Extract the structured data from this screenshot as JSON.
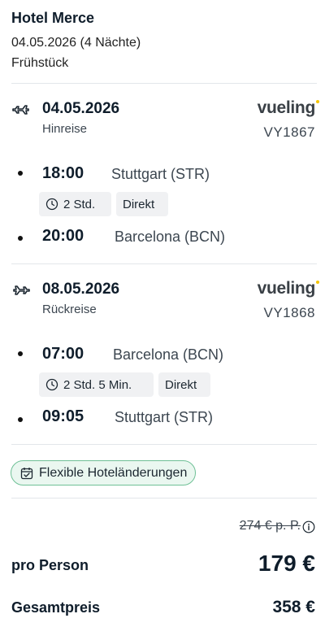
{
  "hotel": {
    "name": "Hotel Merce",
    "dates": "04.05.2026 (4 Nächte)",
    "board": "Frühstück"
  },
  "outbound": {
    "date": "04.05.2026",
    "kind": "Hinreise",
    "airline": "vueling",
    "flight_no": "VY1867",
    "departure_time": "18:00",
    "departure_place": "Stuttgart (STR)",
    "duration": "2 Std.",
    "stops": "Direkt",
    "arrival_time": "20:00",
    "arrival_place": "Barcelona (BCN)"
  },
  "inbound": {
    "date": "08.05.2026",
    "kind": "Rückreise",
    "airline": "vueling",
    "flight_no": "VY1868",
    "departure_time": "07:00",
    "departure_place": "Barcelona (BCN)",
    "duration": "2 Std. 5 Min.",
    "stops": "Direkt",
    "arrival_time": "09:05",
    "arrival_place": "Stuttgart (STR)"
  },
  "badge": {
    "label": "Flexible Hoteländerungen"
  },
  "price": {
    "old_price": "274 € p. P.",
    "per_person_label": "pro Person",
    "per_person_price": "179 €",
    "total_label": "Gesamtpreis",
    "total_price": "358 €"
  },
  "colors": {
    "accent_green": "#6fc096",
    "logo_dot": "#f6c500",
    "text_dark": "#0f1d2b"
  },
  "icons": [
    "plane-takeoff-icon",
    "plane-landing-icon",
    "clock-icon",
    "calendar-check-icon",
    "info-icon"
  ]
}
